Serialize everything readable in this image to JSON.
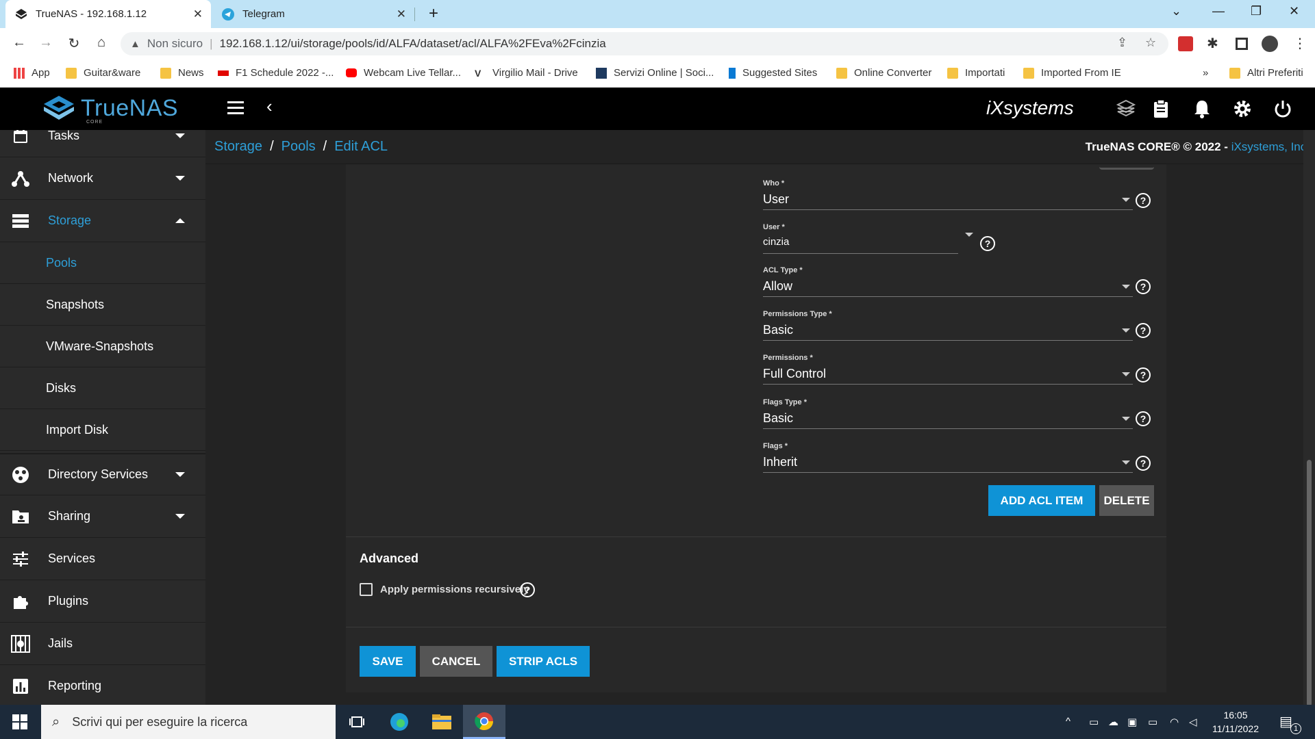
{
  "browser": {
    "tabs": [
      {
        "title": "TrueNAS - 192.168.1.12",
        "active": true
      },
      {
        "title": "Telegram",
        "active": false
      }
    ],
    "address": {
      "security_label": "Non sicuro",
      "url": "192.168.1.12/ui/storage/pools/id/ALFA/dataset/acl/ALFA%2FEva%2Fcinzia"
    },
    "bookmarks": [
      "App",
      "Guitar&ware",
      "News",
      "F1 Schedule 2022 -...",
      "Webcam Live Tellar...",
      "Virgilio Mail - Drive",
      "Servizi Online | Soci...",
      "Suggested Sites",
      "Online Converter",
      "Importati",
      "Imported From IE"
    ],
    "bookmarks_overflow": "»",
    "other_bookmarks": "Altri Preferiti"
  },
  "app": {
    "logo_text": "TrueNAS",
    "logo_sub": "CORE",
    "vendor_logo": "iXsystems",
    "header_icons": [
      "truecommand-icon",
      "clipboard-icon",
      "bell-icon",
      "gear-icon",
      "power-icon"
    ]
  },
  "sidebar": {
    "items": [
      {
        "label": "Tasks",
        "icon": "calendar-icon",
        "arrow": "down"
      },
      {
        "label": "Network",
        "icon": "network-icon",
        "arrow": "down"
      },
      {
        "label": "Storage",
        "icon": "storage-icon",
        "arrow": "up",
        "active": true
      },
      {
        "label": "Directory Services",
        "icon": "directory-icon",
        "arrow": "down"
      },
      {
        "label": "Sharing",
        "icon": "sharing-icon",
        "arrow": "down"
      },
      {
        "label": "Services",
        "icon": "sliders-icon"
      },
      {
        "label": "Plugins",
        "icon": "puzzle-icon"
      },
      {
        "label": "Jails",
        "icon": "jail-icon"
      },
      {
        "label": "Reporting",
        "icon": "chart-icon"
      }
    ],
    "storage_sub": [
      "Pools",
      "Snapshots",
      "VMware-Snapshots",
      "Disks",
      "Import Disk"
    ]
  },
  "breadcrumb": [
    "Storage",
    "Pools",
    "Edit ACL"
  ],
  "copyright": {
    "text": "TrueNAS CORE® © 2022 - ",
    "link": "iXsystems, Inc."
  },
  "acl_item": {
    "who": {
      "label": "Who *",
      "value": "User"
    },
    "user": {
      "label": "User *",
      "value": "cinzia"
    },
    "acl_type": {
      "label": "ACL Type *",
      "value": "Allow"
    },
    "permissions_type": {
      "label": "Permissions Type *",
      "value": "Basic"
    },
    "permissions": {
      "label": "Permissions *",
      "value": "Full Control"
    },
    "flags_type": {
      "label": "Flags Type *",
      "value": "Basic"
    },
    "flags": {
      "label": "Flags *",
      "value": "Inherit"
    },
    "add_button": "ADD ACL ITEM",
    "delete_button": "DELETE"
  },
  "advanced": {
    "title": "Advanced",
    "recursive_label": "Apply permissions recursively",
    "recursive_checked": false
  },
  "actions": {
    "save": "SAVE",
    "cancel": "CANCEL",
    "strip": "STRIP ACLS"
  },
  "taskbar": {
    "search_placeholder": "Scrivi qui per eseguire la ricerca",
    "time": "16:05",
    "date": "11/11/2022",
    "notifications": "1"
  },
  "colors": {
    "accent": "#0f93d6",
    "link": "#2e9fd8",
    "sidebar": "#2a2a2a",
    "card": "#282828"
  }
}
